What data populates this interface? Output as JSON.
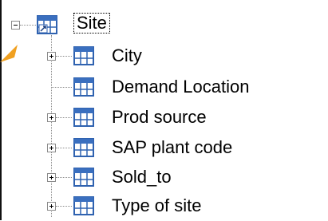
{
  "tree": {
    "root": {
      "label": "Site",
      "expanded": true,
      "icon": "linked-table-icon"
    },
    "children": [
      {
        "label": "City",
        "has_children": true,
        "icon": "table-icon"
      },
      {
        "label": "Demand Location",
        "has_children": false,
        "icon": "table-icon"
      },
      {
        "label": "Prod source",
        "has_children": true,
        "icon": "table-icon"
      },
      {
        "label": "SAP plant code",
        "has_children": true,
        "icon": "table-icon"
      },
      {
        "label": "Sold_to",
        "has_children": true,
        "icon": "table-icon"
      },
      {
        "label": "Type of site",
        "has_children": true,
        "icon": "table-icon"
      }
    ]
  },
  "colors": {
    "cursor": "#f0a020",
    "icon_blue": "#2f62b0",
    "icon_header": "#3a6fbf",
    "selection_border": "#000000"
  }
}
